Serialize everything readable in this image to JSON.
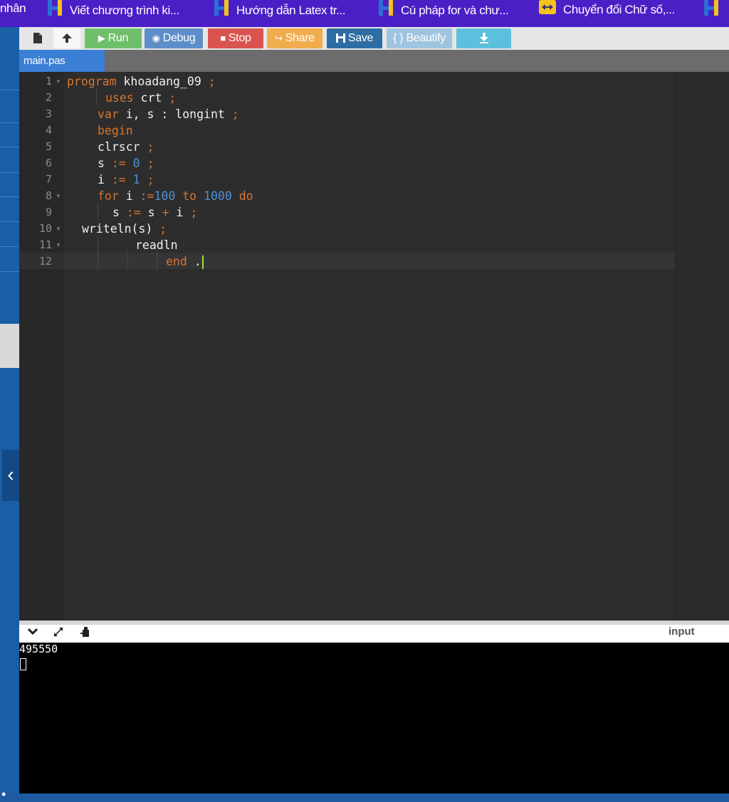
{
  "bookmarks": [
    {
      "label": "nhân",
      "icon": "none"
    },
    {
      "label": "Viết chương trình ki...",
      "icon": "hoc247-icon"
    },
    {
      "label": "Hướng dẫn Latex tr...",
      "icon": "hoc247-icon"
    },
    {
      "label": "Cú pháp for và chư...",
      "icon": "hoc247-icon"
    },
    {
      "label": "Chuyển đổi Chữ số,...",
      "icon": "convert-icon"
    },
    {
      "label": "",
      "icon": "hoc247-icon"
    }
  ],
  "toolbar": {
    "run_label": "Run",
    "debug_label": "Debug",
    "stop_label": "Stop",
    "share_label": "Share",
    "save_label": "Save",
    "beautify_label": "{ } Beautify"
  },
  "tab": {
    "filename": "main.pas"
  },
  "editor": {
    "line_numbers": [
      "1",
      "2",
      "3",
      "4",
      "5",
      "6",
      "7",
      "8",
      "9",
      "10",
      "11",
      "12"
    ],
    "code": {
      "l1_kw": "program",
      "l1_rest": " khoadang_09 ",
      "l1_semi": ";",
      "l2_kw": "uses",
      "l2_rest": " crt ",
      "l2_semi": ";",
      "l3_kw": "var",
      "l3_rest": " i, s : longint ",
      "l3_semi": ";",
      "l4_kw": "begin",
      "l5_rest": "clrscr ",
      "l5_semi": ";",
      "l6_a": "s ",
      "l6_op": ":=",
      "l6_num": " 0 ",
      "l6_semi": ";",
      "l7_a": "i ",
      "l7_op": ":=",
      "l7_num": " 1 ",
      "l7_semi": ";",
      "l8_kw": "for",
      "l8_a": " i ",
      "l8_op": ":=",
      "l8_num1": "100",
      "l8_to": " to ",
      "l8_num2": "1000",
      "l8_do": " do",
      "l9_a": "s ",
      "l9_op": ":=",
      "l9_b": " s ",
      "l9_plus": "+",
      "l9_c": " i ",
      "l9_semi": ";",
      "l10_a": "writeln(s) ",
      "l10_semi": ";",
      "l11_a": "readln",
      "l12_kw": "end",
      "l12_dot": " ."
    }
  },
  "output": {
    "input_label": "input",
    "console_text": "495550"
  },
  "colors": {
    "bookmarks_bg": "#4b1fc6",
    "run": "#6fbf6a",
    "debug": "#5d8ec9",
    "stop": "#d9534f",
    "share": "#f0ad4e",
    "save": "#2e6da4",
    "beautify": "#9fc4e0",
    "download": "#5bc0de",
    "keyword": "#d9742f",
    "number": "#4f8fd4"
  }
}
